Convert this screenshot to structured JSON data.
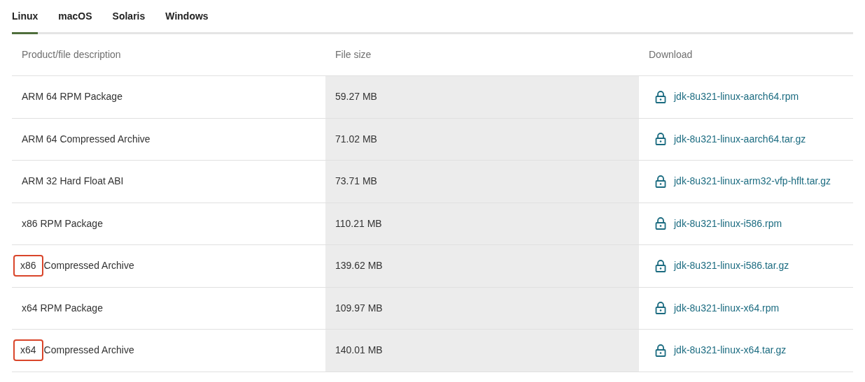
{
  "tabs": [
    {
      "label": "Linux",
      "selected": true
    },
    {
      "label": "macOS",
      "selected": false
    },
    {
      "label": "Solaris",
      "selected": false
    },
    {
      "label": "Windows",
      "selected": false
    }
  ],
  "table": {
    "columns": [
      "Product/file description",
      "File size",
      "Download"
    ],
    "rows": [
      {
        "description": "ARM 64 RPM Package",
        "size": "59.27 MB",
        "file": "jdk-8u321-linux-aarch64.rpm"
      },
      {
        "description": "ARM 64 Compressed Archive",
        "size": "71.02 MB",
        "file": "jdk-8u321-linux-aarch64.tar.gz"
      },
      {
        "description": "ARM 32 Hard Float ABI",
        "size": "73.71 MB",
        "file": "jdk-8u321-linux-arm32-vfp-hflt.tar.gz"
      },
      {
        "description": "x86 RPM Package",
        "size": "110.21 MB",
        "file": "jdk-8u321-linux-i586.rpm"
      },
      {
        "boxed_prefix": "x86",
        "description": "Compressed Archive",
        "size": "139.62 MB",
        "file": "jdk-8u321-linux-i586.tar.gz"
      },
      {
        "description": "x64 RPM Package",
        "size": "109.97 MB",
        "file": "jdk-8u321-linux-x64.rpm"
      },
      {
        "boxed_prefix": "x64",
        "description": "Compressed Archive",
        "size": "140.01 MB",
        "file": "jdk-8u321-linux-x64.tar.gz"
      }
    ]
  }
}
